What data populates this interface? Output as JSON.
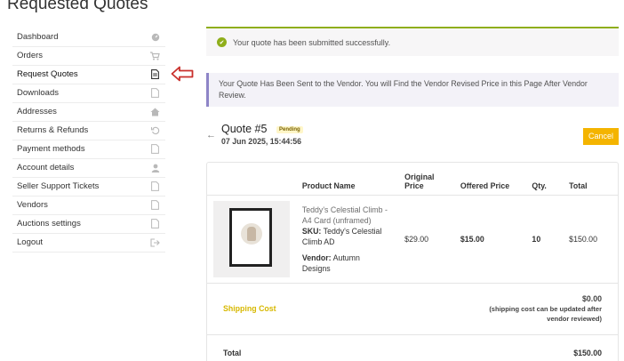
{
  "page_title": "Requested Quotes",
  "sidebar": {
    "items": [
      {
        "label": "Dashboard",
        "icon": "dashboard-icon"
      },
      {
        "label": "Orders",
        "icon": "cart-icon"
      },
      {
        "label": "Request Quotes",
        "icon": "document-icon",
        "active": true
      },
      {
        "label": "Downloads",
        "icon": "file-icon"
      },
      {
        "label": "Addresses",
        "icon": "home-icon"
      },
      {
        "label": "Returns & Refunds",
        "icon": "undo-icon"
      },
      {
        "label": "Payment methods",
        "icon": "file-icon"
      },
      {
        "label": "Account details",
        "icon": "user-icon"
      },
      {
        "label": "Seller Support Tickets",
        "icon": "file-icon"
      },
      {
        "label": "Vendors",
        "icon": "file-icon"
      },
      {
        "label": "Auctions settings",
        "icon": "file-icon"
      },
      {
        "label": "Logout",
        "icon": "logout-icon"
      }
    ]
  },
  "notice": {
    "text": "Your quote has been submitted successfully."
  },
  "info": {
    "text": "Your Quote Has Been Sent to the Vendor. You will Find the Vendor Revised Price in this Page After Vendor Review."
  },
  "quote": {
    "title": "Quote #5",
    "status": "Pending",
    "date": "07 Jun 2025, 15:44:56",
    "cancel_label": "Cancel"
  },
  "table": {
    "headers": {
      "product": "Product Name",
      "original_1": "Original",
      "original_2": "Price",
      "offered": "Offered Price",
      "qty": "Qty.",
      "total": "Total"
    },
    "row": {
      "name_1": "Teddy's Celestial Climb -",
      "name_2": "A4 Card (unframed)",
      "sku_label": "SKU:",
      "sku_1": "Teddy's Celestial",
      "sku_2": "Climb AD",
      "vendor_label": "Vendor:",
      "vendor_1": "Autumn",
      "vendor_2": "Designs",
      "original_price": "$29.00",
      "offered_price": "$15.00",
      "qty": "10",
      "total": "$150.00"
    },
    "shipping": {
      "label": "Shipping Cost",
      "value": "$0.00",
      "note_1": "(shipping cost can be updated after",
      "note_2": "vendor reviewed)"
    },
    "grand_total": {
      "label": "Total",
      "value": "$150.00"
    }
  },
  "colors": {
    "accent_green": "#8fae1b",
    "accent_yellow": "#f4b400",
    "info_border": "#8e85c7",
    "arrow_red": "#c9302c"
  }
}
